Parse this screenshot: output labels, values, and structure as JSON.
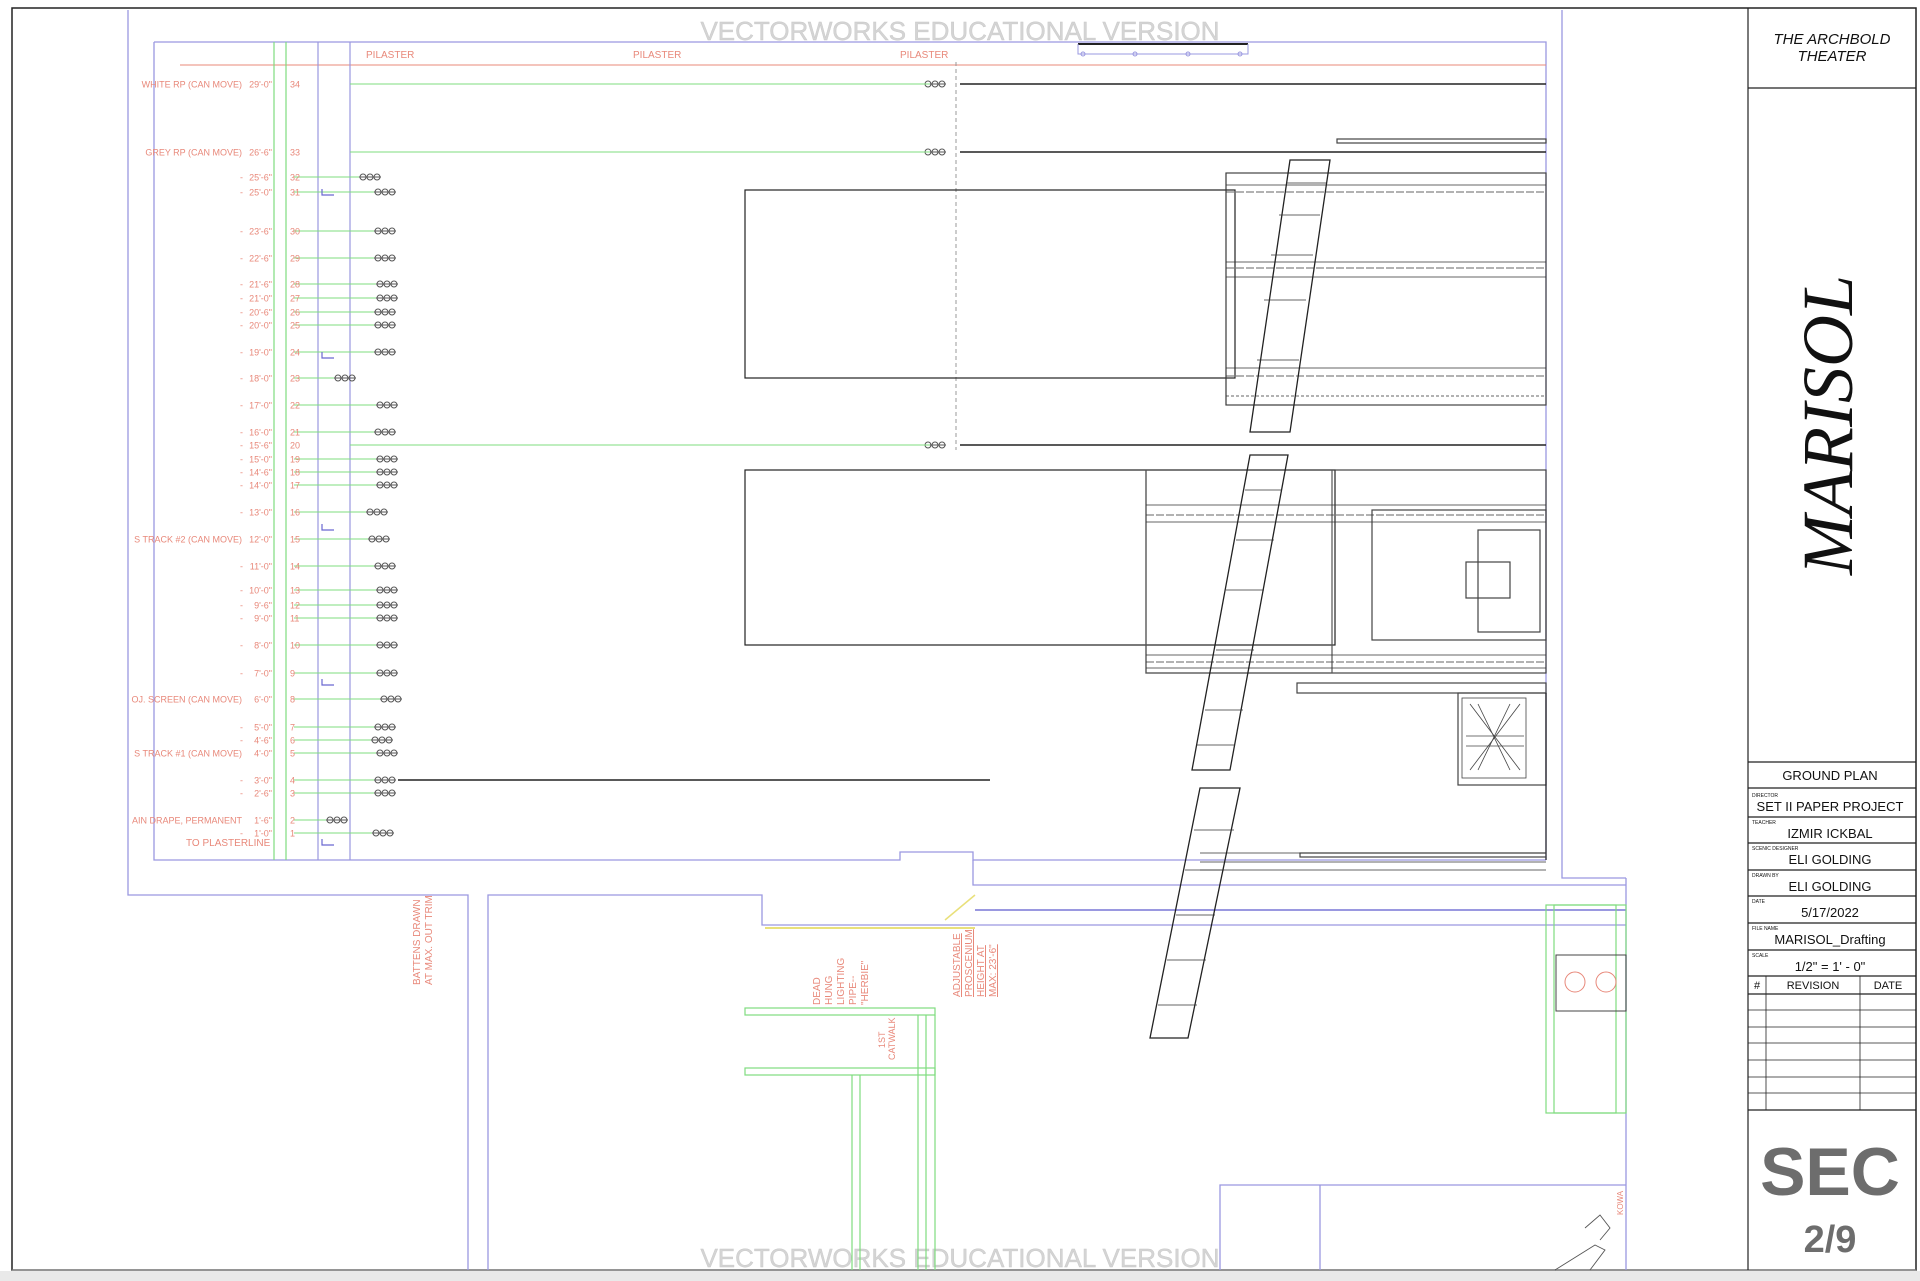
{
  "watermark": "VECTORWORKS EDUCATIONAL VERSION",
  "pilaster_labels": [
    "PILASTER",
    "PILASTER",
    "PILASTER"
  ],
  "lineset": [
    {
      "name": "WHITE RP (CAN MOVE)",
      "dist": "29'-0\"",
      "num": "34"
    },
    {
      "name": "GREY RP (CAN MOVE)",
      "dist": "26'-6\"",
      "num": "33"
    },
    {
      "name": "",
      "dist": "25'-6\"",
      "num": "32"
    },
    {
      "name": "",
      "dist": "25'-0\"",
      "num": "31"
    },
    {
      "name": "",
      "dist": "23'-6\"",
      "num": "30"
    },
    {
      "name": "",
      "dist": "22'-6\"",
      "num": "29"
    },
    {
      "name": "",
      "dist": "21'-6\"",
      "num": "28"
    },
    {
      "name": "",
      "dist": "21'-0\"",
      "num": "27"
    },
    {
      "name": "",
      "dist": "20'-6\"",
      "num": "26"
    },
    {
      "name": "",
      "dist": "20'-0\"",
      "num": "25"
    },
    {
      "name": "",
      "dist": "19'-0\"",
      "num": "24"
    },
    {
      "name": "",
      "dist": "18'-0\"",
      "num": "23"
    },
    {
      "name": "",
      "dist": "17'-0\"",
      "num": "22"
    },
    {
      "name": "",
      "dist": "16'-0\"",
      "num": "21"
    },
    {
      "name": "",
      "dist": "15'-6\"",
      "num": "20"
    },
    {
      "name": "",
      "dist": "15'-0\"",
      "num": "19"
    },
    {
      "name": "",
      "dist": "14'-6\"",
      "num": "18"
    },
    {
      "name": "",
      "dist": "14'-0\"",
      "num": "17"
    },
    {
      "name": "",
      "dist": "13'-0\"",
      "num": "16"
    },
    {
      "name": "S TRACK #2 (CAN MOVE)",
      "dist": "12'-0\"",
      "num": "15"
    },
    {
      "name": "",
      "dist": "11'-0\"",
      "num": "14"
    },
    {
      "name": "",
      "dist": "10'-0\"",
      "num": "13"
    },
    {
      "name": "",
      "dist": "9'-6\"",
      "num": "12"
    },
    {
      "name": "",
      "dist": "9'-0\"",
      "num": "11"
    },
    {
      "name": "",
      "dist": "8'-0\"",
      "num": "10"
    },
    {
      "name": "",
      "dist": "7'-0\"",
      "num": "9"
    },
    {
      "name": "OJ. SCREEN (CAN MOVE)",
      "dist": "6'-0\"",
      "num": "8"
    },
    {
      "name": "",
      "dist": "5'-0\"",
      "num": "7"
    },
    {
      "name": "",
      "dist": "4'-6\"",
      "num": "6"
    },
    {
      "name": "S TRACK #1 (CAN MOVE)",
      "dist": "4'-0\"",
      "num": "5"
    },
    {
      "name": "",
      "dist": "3'-0\"",
      "num": "4"
    },
    {
      "name": "",
      "dist": "2'-6\"",
      "num": "3"
    },
    {
      "name": "AIN DRAPE, PERMANENT",
      "dist": "1'-6\"",
      "num": "2"
    },
    {
      "name": "",
      "dist": "1'-0\"",
      "num": "1"
    }
  ],
  "to_plasterline": "TO PLASTERLINE",
  "notes": {
    "battens": [
      "BATTENS DRAWN",
      "AT MAX. OUT TRIM"
    ],
    "dead_hung": [
      "DEAD",
      "HUNG",
      "LIGHTING",
      "PIPE--",
      "\"HERBIE\""
    ],
    "catwalk": [
      "1ST",
      "CATWALK"
    ],
    "proscenium": [
      "ADJUSTABLE",
      "PROSCENIUM",
      "HEIGHT AT",
      "MAX: 23'-6\""
    ],
    "edge": "KOWA"
  },
  "title_block": {
    "theater_line1": "THE ARCHBOLD",
    "theater_line2": "THEATER",
    "show_title": "MARISOL",
    "sheet_name": "GROUND PLAN",
    "director_label": "DIRECTOR",
    "director": "SET II PAPER PROJECT",
    "teacher_label": "TEACHER",
    "teacher": "IZMIR ICKBAL",
    "designer_label": "SCENIC DESIGNER",
    "designer": "ELI GOLDING",
    "drawn_label": "DRAWN BY",
    "drawn_by": "ELI GOLDING",
    "date_label": "DATE",
    "date": "5/17/2022",
    "file_label": "FILE NAME",
    "file_name": "MARISOL_Drafting",
    "scale_label": "SCALE",
    "scale": "1/2\" = 1' - 0\"",
    "rev_headers": [
      "#",
      "REVISION",
      "DATE"
    ],
    "sheet_code": "SEC",
    "sheet_number": "2/9"
  },
  "colors": {
    "label_red": "#e8887a",
    "grid_green": "#7fdc7f",
    "wall_blue": "#9a98e0",
    "ink": "#111111",
    "watermark": "#d4d4d4",
    "sheet_gray": "#6d6d6d"
  }
}
